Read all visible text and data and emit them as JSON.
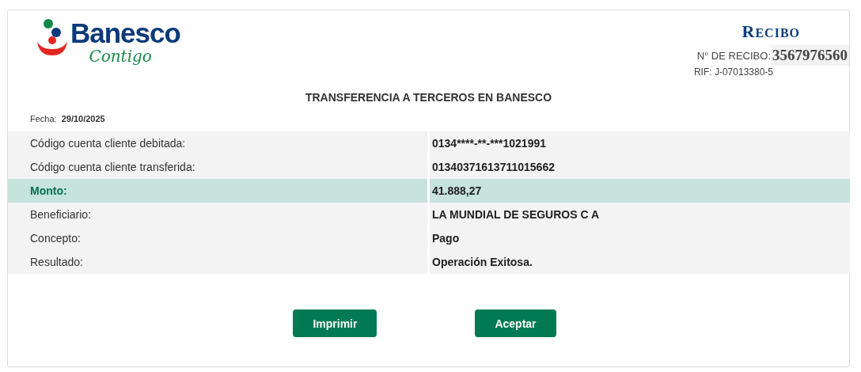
{
  "logo": {
    "name": "Banesco",
    "tagline": "Contigo"
  },
  "receipt": {
    "title": "RECIBO",
    "number_label": "N° DE RECIBO:",
    "number": "3567976560",
    "rif": "RIF: J-07013380-5"
  },
  "heading": "TRANSFERENCIA A TERCEROS EN BANESCO",
  "date": {
    "label": "Fecha:",
    "value": "29/10/2025"
  },
  "rows": [
    {
      "label": "Código cuenta cliente debitada:",
      "value": "0134****-**-***1021991",
      "highlighted": false
    },
    {
      "label": "Código cuenta cliente transferida:",
      "value": "01340371613711015662",
      "highlighted": false
    },
    {
      "label": "Monto:",
      "value": "41.888,27",
      "highlighted": true
    },
    {
      "label": "Beneficiario:",
      "value": "LA MUNDIAL DE SEGUROS C A",
      "highlighted": false
    },
    {
      "label": "Concepto:",
      "value": "Pago",
      "highlighted": false
    },
    {
      "label": "Resultado:",
      "value": "Operación Exitosa.",
      "highlighted": false
    }
  ],
  "buttons": [
    "Imprimir",
    "Aceptar"
  ]
}
